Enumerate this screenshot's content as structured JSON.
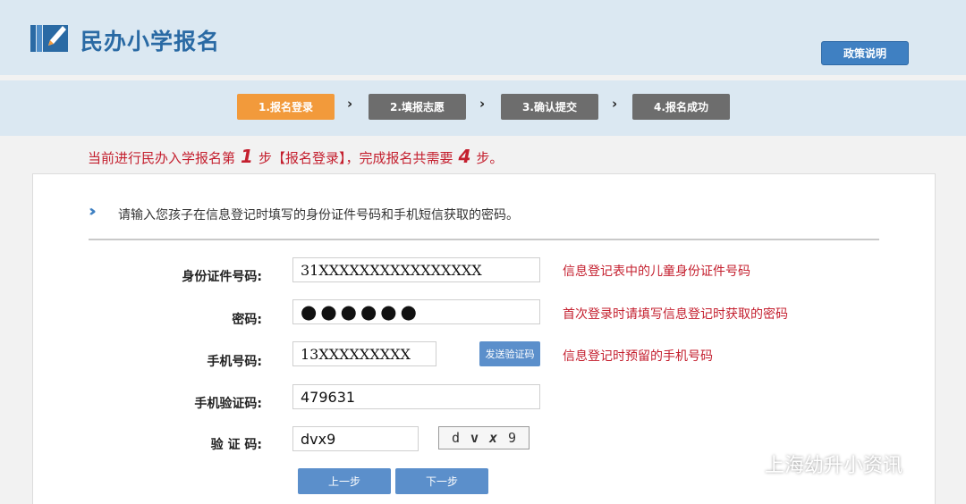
{
  "header": {
    "site_title": "民办小学报名",
    "logo_icon": "pencil-book-icon",
    "policy_button": "政策说明"
  },
  "steps": [
    {
      "label": "1.报名登录",
      "active": true
    },
    {
      "label": "2.填报志愿",
      "active": false
    },
    {
      "label": "3.确认提交",
      "active": false
    },
    {
      "label": "4.报名成功",
      "active": false
    }
  ],
  "step_separator": "›",
  "notice": {
    "prefix": "当前进行民办入学报名第",
    "current_step": "1",
    "middle": "步【报名登录】，完成报名共需要",
    "total_steps": "4",
    "suffix": "步。"
  },
  "form": {
    "instruction": "请输入您孩子在信息登记时填写的身份证件号码和手机短信获取的密码。",
    "id_number": {
      "label": "身份证件号码:",
      "value": "31XXXXXXXXXXXXXXXX",
      "hint": "信息登记表中的儿童身份证件号码"
    },
    "password": {
      "label": "密码:",
      "value": "●●●●●●",
      "hint": "首次登录时请填写信息登记时获取的密码"
    },
    "phone": {
      "label": "手机号码:",
      "value": "13XXXXXXXXX",
      "hint": "信息登记时预留的手机号码",
      "send_button": "发送验证码"
    },
    "sms_code": {
      "label": "手机验证码:",
      "value": "479631"
    },
    "captcha": {
      "label": "验 证 码:",
      "value": "dvx9",
      "image_chars": [
        "d",
        "v",
        "x",
        "9"
      ]
    },
    "prev_button": "上一步",
    "next_button": "下一步"
  },
  "watermark": {
    "text": "上海幼升小资讯",
    "icon": "wechat-icon"
  },
  "colors": {
    "header_bg": "#dbe8f2",
    "title_blue": "#2a6aa4",
    "button_blue": "#5b8fcb",
    "step_active": "#f29a3b",
    "step_inactive": "#6d6d6d",
    "hint_red": "#c41f2e"
  }
}
